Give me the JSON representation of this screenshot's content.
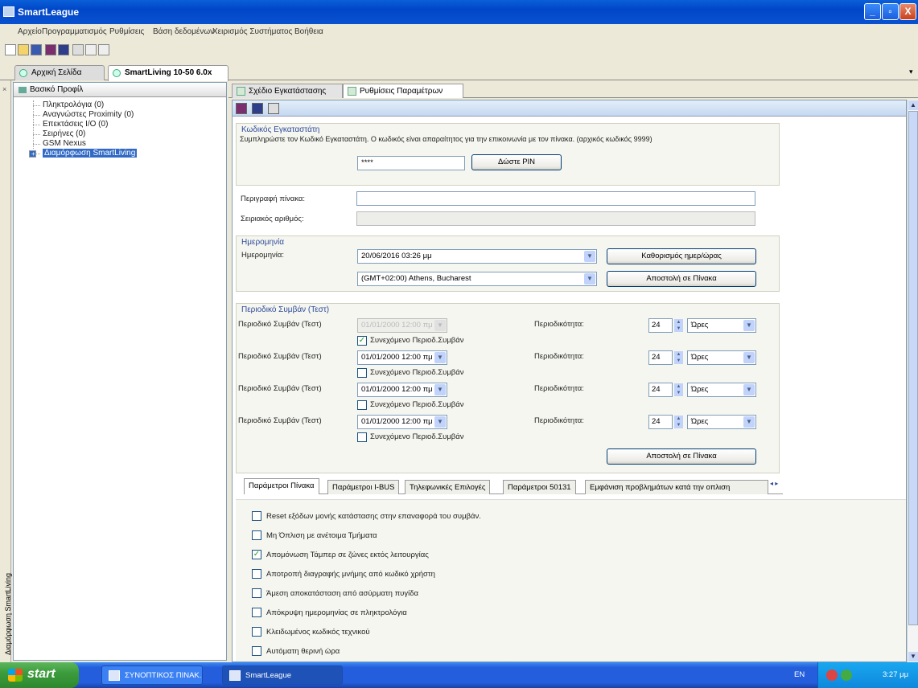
{
  "window": {
    "title": "SmartLeague",
    "min": "_",
    "max": "▫",
    "close": "X"
  },
  "menu": [
    "Αρχείο",
    "Προγραμματισμός",
    "Ρυθμίσεις",
    "Βάση δεδομένων",
    "Χειρισμός Συστήματος",
    "Βοήθεια"
  ],
  "doc_tabs": [
    "Αρχική Σελίδα",
    "SmartLiving 10-50 6.0x"
  ],
  "tree": {
    "header": "Βασικό Προφίλ",
    "items": [
      "Πληκτρολόγια (0)",
      "Αναγνώστες Proximity (0)",
      "Επεκτάσεις I/O (0)",
      "Σειρήνες (0)",
      "GSM Nexus",
      "Διαμόρφωση SmartLiving"
    ]
  },
  "side_strip_label": "Διαμόρφωση SmartLiving",
  "sub_tabs": [
    "Σχέδιο Εγκατάστασης",
    "Ρυθμίσεις Παραμέτρων"
  ],
  "installer": {
    "title": "Κωδικός Εγκαταστάτη",
    "description": "Συμπληρώστε τον Κωδικό Εγκαταστάτη. Ο κωδικός είναι απαραίτητος για την επικοινωνία με τον πίνακα. (αρχικός κωδικός 9999)",
    "pin_value": "****",
    "pin_button": "Δώστε PIN"
  },
  "panel": {
    "description_label": "Περιγραφή πίνακα:",
    "description_value": "",
    "serial_label": "Σειριακός αριθμός:",
    "serial_value": ""
  },
  "date_section": {
    "title": "Ημερομηνία",
    "date_label": "Ημερομηνία:",
    "date_value": "20/06/2016   03:26 μμ",
    "timezone_value": "(GMT+02:00) Athens, Bucharest",
    "set_today_button": "Καθορισμός ημερ/ώρας",
    "send_button": "Αποστολή σε Πίνακα"
  },
  "periodic": {
    "title": "Περιοδικό Συμβάν (Τεστ)",
    "row_label": "Περιοδικό Συμβάν (Τεστ)",
    "periodicity_label": "Περιοδικότητα:",
    "continuous_label": "Συνεχόμενο Περιοδ.Συμβάν",
    "rows": [
      {
        "date": "01/01/2000   12:00 πμ",
        "disabled": true,
        "checked": true,
        "period": "24",
        "unit": "Ώρες"
      },
      {
        "date": "01/01/2000   12:00 πμ",
        "disabled": false,
        "checked": false,
        "period": "24",
        "unit": "Ώρες"
      },
      {
        "date": "01/01/2000   12:00 πμ",
        "disabled": false,
        "checked": false,
        "period": "24",
        "unit": "Ώρες"
      },
      {
        "date": "01/01/2000   12:00 πμ",
        "disabled": false,
        "checked": false,
        "period": "24",
        "unit": "Ώρες"
      }
    ],
    "send_button": "Αποστολή σε Πίνακα"
  },
  "bottom_tabs": [
    "Παράμετροι Πίνακα",
    "Παράμετροι I-BUS",
    "Τηλεφωνικές Επιλογές",
    "Παράμετροι 50131",
    "Εμφάνιση προβλημάτων κατά την οπλιση"
  ],
  "options": [
    {
      "label": "Reset εξόδων μονής κατάστασης στην επαναφορά του συμβάν.",
      "checked": false
    },
    {
      "label": "Μη Όπλιση με ανέτοιμα Τμήματα",
      "checked": false
    },
    {
      "label": "Απομόνωση Τάμπερ σε ζώνες εκτός λειτουργίας",
      "checked": true
    },
    {
      "label": "Αποτροπή διαγραφής μνήμης από κωδικό χρήστη",
      "checked": false
    },
    {
      "label": "Άμεση αποκατάσταση από ασύρματη πυγίδα",
      "checked": false
    },
    {
      "label": "Απόκρυψη ημερομηνίας σε πληκτρολόγια",
      "checked": false
    },
    {
      "label": "Κλειδωμένος κωδικός τεχνικού",
      "checked": false
    },
    {
      "label": "Αυτόματη θερινή ώρα",
      "checked": false
    }
  ],
  "taskbar": {
    "start": "start",
    "items": [
      "ΣΥΝΟΠΤΙΚΟΣ ΠΙΝΑΚ...",
      "SmartLeague"
    ],
    "lang": "EN",
    "clock": "3:27 μμ"
  },
  "colors": {
    "titlebar": "#0046C8",
    "accent_text": "#2C4A9A",
    "taskbar": "#245EDC",
    "start": "#3C9C3C"
  }
}
